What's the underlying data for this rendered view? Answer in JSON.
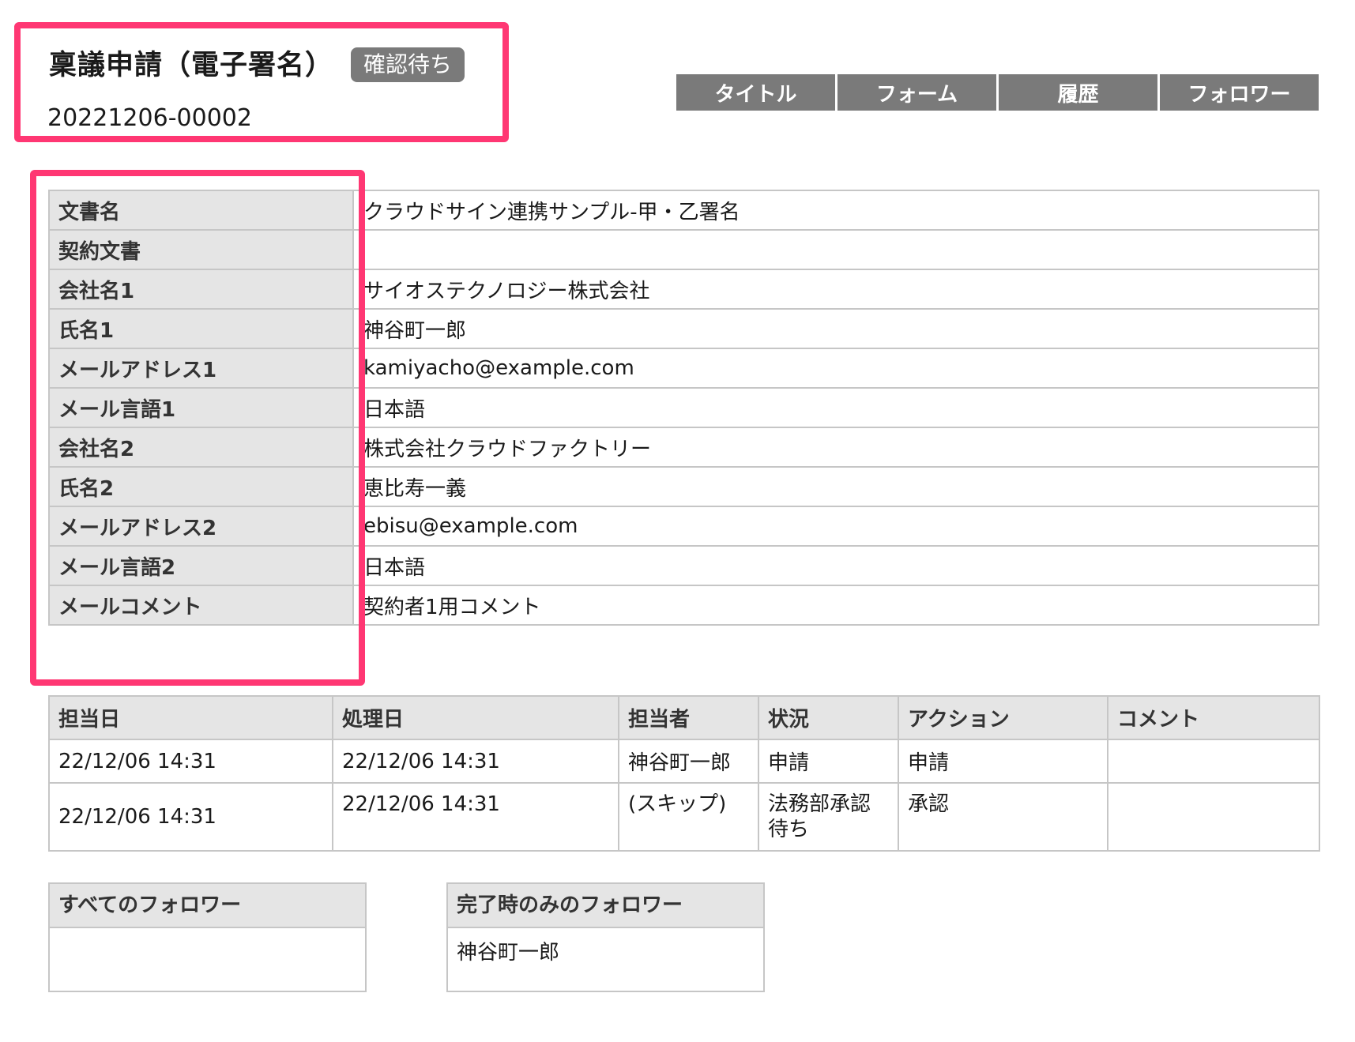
{
  "header": {
    "title": "稟議申請（電子署名）",
    "status": "確認待ち",
    "number": "20221206-00002"
  },
  "tabs": [
    "タイトル",
    "フォーム",
    "履歴",
    "フォロワー"
  ],
  "fields": [
    {
      "label": "文書名",
      "value": "クラウドサイン連携サンプル-甲・乙署名"
    },
    {
      "label": "契約文書",
      "value": ""
    },
    {
      "label": "会社名1",
      "value": "サイオステクノロジー株式会社"
    },
    {
      "label": "氏名1",
      "value": "神谷町一郎"
    },
    {
      "label": "メールアドレス1",
      "value": "kamiyacho@example.com"
    },
    {
      "label": "メール言語1",
      "value": "日本語"
    },
    {
      "label": "会社名2",
      "value": "株式会社クラウドファクトリー"
    },
    {
      "label": "氏名2",
      "value": "恵比寿一義"
    },
    {
      "label": "メールアドレス2",
      "value": "ebisu@example.com"
    },
    {
      "label": "メール言語2",
      "value": "日本語"
    },
    {
      "label": "メールコメント",
      "value": "契約者1用コメント"
    }
  ],
  "history": {
    "columns": [
      "担当日",
      "処理日",
      "担当者",
      "状況",
      "アクション",
      "コメント"
    ],
    "rows": [
      [
        "22/12/06 14:31",
        "22/12/06 14:31",
        "神谷町一郎",
        "申請",
        "申請",
        ""
      ],
      [
        "22/12/06 14:31",
        "22/12/06 14:31",
        "(スキップ)",
        "法務部承認待ち",
        "承認",
        ""
      ]
    ]
  },
  "followers": {
    "all_label": "すべてのフォロワー",
    "all_value": "",
    "complete_label": "完了時のみのフォロワー",
    "complete_value": "神谷町一郎"
  },
  "colors": {
    "highlight": "#ff3773",
    "tab_bg": "#7a7a7a",
    "header_cell_bg": "#e5e5e5"
  }
}
